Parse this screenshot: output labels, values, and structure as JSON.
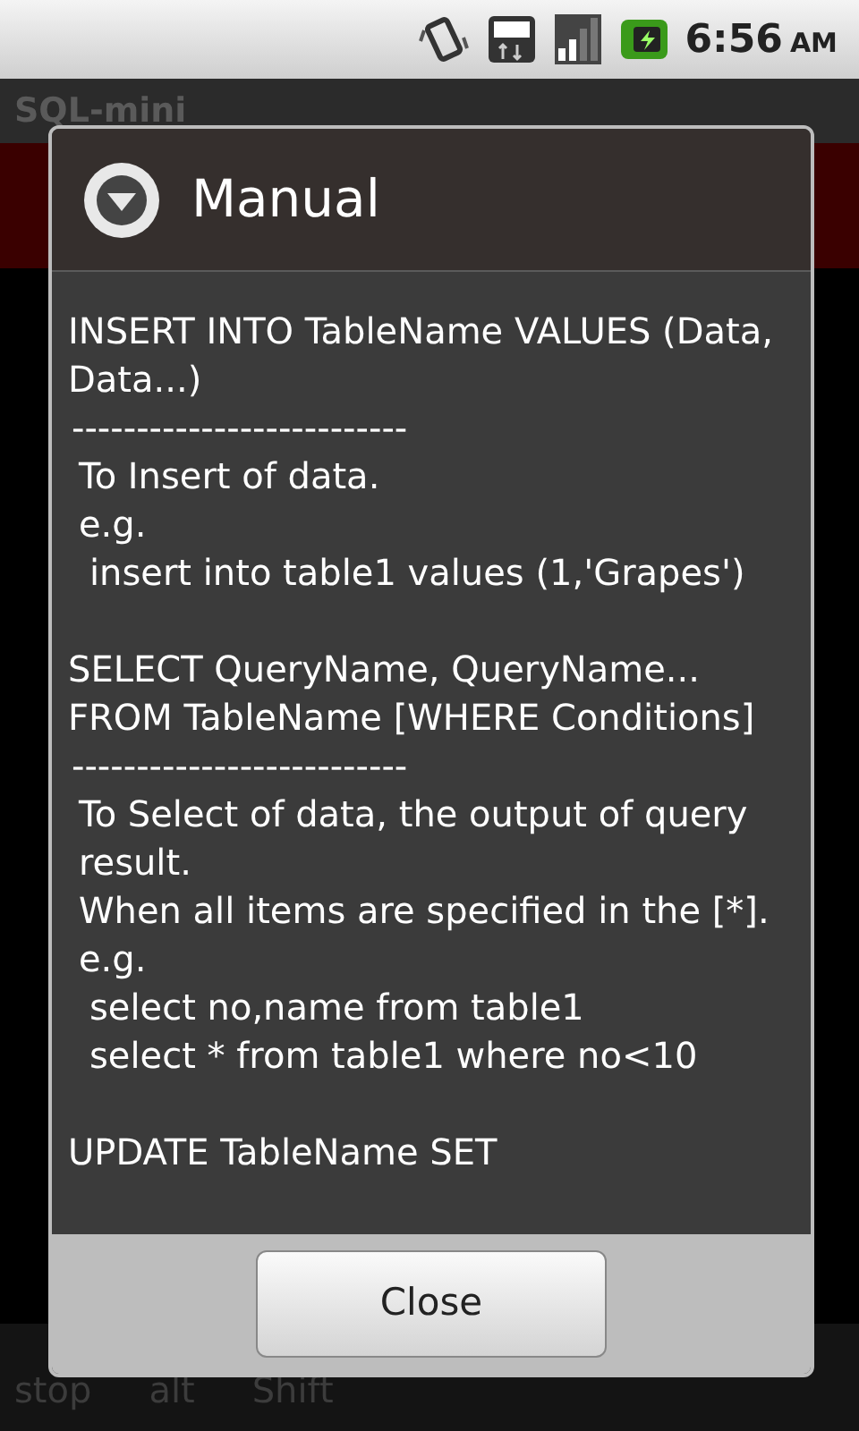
{
  "status_bar": {
    "time": "6:56",
    "am_pm": "AM"
  },
  "app": {
    "title": "SQL-mini",
    "keyboard_bottom_row": [
      "stop",
      "alt",
      "Shift"
    ]
  },
  "dialog": {
    "title": "Manual",
    "sections": [
      {
        "lines": [
          {
            "kind": "statement",
            "text": "INSERT INTO TableName VALUES (Data, Data...)"
          },
          {
            "kind": "rule",
            "text": "--------------------------"
          },
          {
            "kind": "note",
            "text": "To Insert of data."
          },
          {
            "kind": "note",
            "text": "e.g."
          },
          {
            "kind": "example",
            "text": "insert into table1 values (1,'Grapes')"
          }
        ]
      },
      {
        "lines": [
          {
            "kind": "statement",
            "text": "SELECT QueryName, QueryName... FROM TableName [WHERE Conditions]"
          },
          {
            "kind": "rule",
            "text": "--------------------------"
          },
          {
            "kind": "note",
            "text": "To Select of data, the output of query result."
          },
          {
            "kind": "note",
            "text": "When all items are specified in the [*]."
          },
          {
            "kind": "note",
            "text": "e.g."
          },
          {
            "kind": "example",
            "text": "select no,name from table1"
          },
          {
            "kind": "example",
            "text": "select * from table1 where no<10"
          }
        ]
      },
      {
        "lines": [
          {
            "kind": "statement",
            "text": "UPDATE TableName SET"
          }
        ]
      }
    ],
    "button": "Close"
  }
}
